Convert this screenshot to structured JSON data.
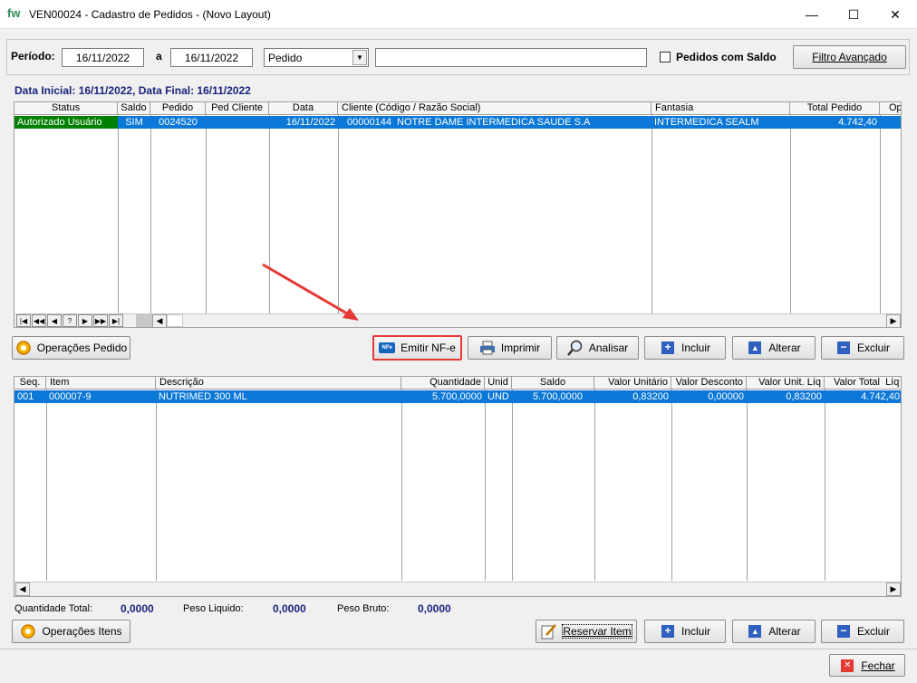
{
  "window": {
    "logo": "fw",
    "title": "VEN00024 - Cadastro de Pedidos - (Novo Layout)",
    "minimize": "—",
    "maximize": "☐",
    "close": "✕"
  },
  "filters": {
    "periodo_label": "Período:",
    "date_from": "16/11/2022",
    "a_label": "a",
    "date_to": "16/11/2022",
    "type_select": "Pedido",
    "search_value": "",
    "pedidos_saldo_label": "Pedidos com Saldo",
    "filtro_avancado": "Filtro Avançado"
  },
  "orders": {
    "period_info": "Data Inicial: 16/11/2022, Data Final: 16/11/2022",
    "columns": [
      "Status",
      "Saldo",
      "Pedido",
      "Ped Cliente",
      "Data",
      "Cliente (Código / Razão Social)",
      "Fantasia",
      "Total Pedido",
      "Op"
    ],
    "rows": [
      {
        "status": "Autorizado Usuário",
        "saldo": "SIM",
        "pedido": "0024520",
        "ped_cliente": "",
        "data": "16/11/2022",
        "cliente": "00000144  NOTRE DAME INTERMEDICA SAUDE S.A",
        "fantasia": "INTERMEDICA SEALM",
        "total": "4.742,40",
        "op": ""
      }
    ],
    "nav": [
      "|◀",
      "◀◀",
      "◀",
      "?",
      "▶",
      "▶▶",
      "▶|"
    ]
  },
  "order_actions": {
    "operacoes": "Operações Pedido",
    "emitir": "Emitir NF-e",
    "emitir_icon_text": "NFe",
    "imprimir": "Imprimir",
    "analisar": "Analisar",
    "incluir": "Incluir",
    "alterar": "Alterar",
    "excluir": "Excluir"
  },
  "items": {
    "columns": [
      "Seq.",
      "Item",
      "Descrição",
      "Quantidade",
      "Unid",
      "Saldo",
      "Valor Unitário",
      "Valor Desconto",
      "Valor Unit. Líq",
      "Valor Total  Líq"
    ],
    "rows": [
      {
        "seq": "001",
        "item": "000007-9",
        "descricao": "NUTRIMED 300 ML",
        "quantidade": "5.700,0000",
        "unid": "UND",
        "saldo": "5.700,0000",
        "valor_unitario": "0,83200",
        "valor_desconto": "0,00000",
        "valor_unit_liq": "0,83200",
        "valor_total_liq": "4.742,40"
      }
    ]
  },
  "totals": {
    "qtd_label": "Quantidade Total:",
    "qtd_value": "0,0000",
    "peso_liq_label": "Peso Liquido:",
    "peso_liq_value": "0,0000",
    "peso_bruto_label": "Peso Bruto:",
    "peso_bruto_value": "0,0000"
  },
  "item_actions": {
    "operacoes": "Operações Itens",
    "reservar": "Reservar Item",
    "incluir": "Incluir",
    "alterar": "Alterar",
    "excluir": "Excluir"
  },
  "footer": {
    "fechar": "Fechar"
  },
  "colors": {
    "selection": "#0b78d7",
    "status_green": "#008000",
    "highlight_red": "#e53935"
  }
}
